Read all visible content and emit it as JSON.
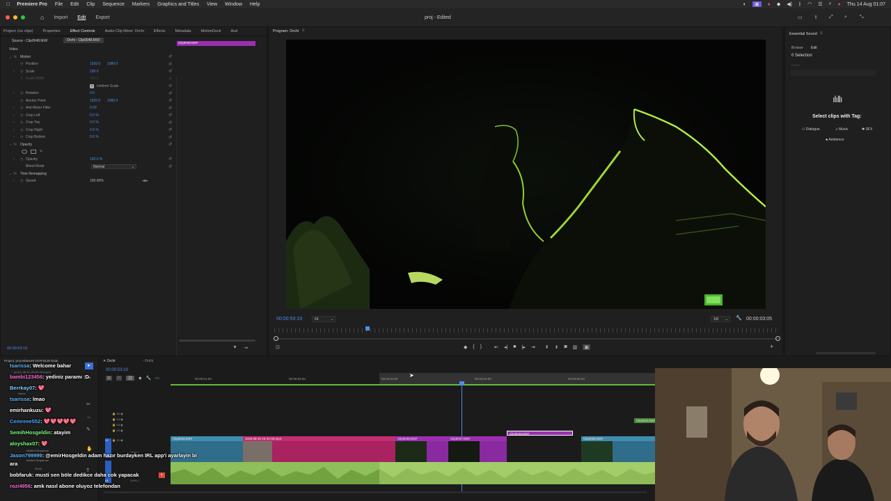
{
  "menubar": {
    "app": "Premiere Pro",
    "items": [
      "File",
      "Edit",
      "Clip",
      "Sequence",
      "Markers",
      "Graphics and Titles",
      "View",
      "Window",
      "Help"
    ],
    "datetime": "Thu 14 Aug  01:07"
  },
  "titlebar": {
    "nav": [
      "Import",
      "Edit",
      "Export"
    ],
    "active_nav": "Edit",
    "doc_title": "proj - Edited"
  },
  "effect_controls": {
    "tabs": [
      "Project: (no clips)",
      "Properties",
      "Effect Controls",
      "Audio Clip Mixer: Orchi",
      "Effects",
      "Metadata",
      "MotionDuck",
      "Aud"
    ],
    "source_label": "Source - Clip0048.MXF",
    "sequence_label": "Orchi - Clip0048.MXF",
    "mini_clip": "Clip0048.MXF",
    "section_video": "Video",
    "rows": [
      {
        "label": "Motion",
        "header": true
      },
      {
        "label": "Position",
        "v1": "1920.0",
        "v2": "1080.0"
      },
      {
        "label": "Scale",
        "v1": "100.0"
      },
      {
        "label": "Scale Width",
        "v1": "100.0",
        "dim": true
      },
      {
        "label": "Uniform Scale",
        "checkbox": true
      },
      {
        "label": "Rotation",
        "v1": "0.0"
      },
      {
        "label": "Anchor Point",
        "v1": "1920.0",
        "v2": "1080.0"
      },
      {
        "label": "Anti-flicker Filter",
        "v1": "0.00"
      },
      {
        "label": "Crop Left",
        "v1": "0.0 %"
      },
      {
        "label": "Crop Top",
        "v1": "0.0 %"
      },
      {
        "label": "Crop Right",
        "v1": "0.0 %"
      },
      {
        "label": "Crop Bottom",
        "v1": "0.0 %"
      },
      {
        "label": "Opacity",
        "header": true
      },
      {
        "label": "",
        "masks": true
      },
      {
        "label": "Opacity",
        "v1": "100.0 %"
      },
      {
        "label": "Blend Mode",
        "select": "Normal"
      },
      {
        "label": "Time Remapping",
        "header": true
      },
      {
        "label": "Speed",
        "v1": "100.00%"
      }
    ],
    "timecode": "00:00:53:19"
  },
  "program_monitor": {
    "title": "Program: Orchi",
    "timecode": "00:00:53:19",
    "fit": "Fit",
    "resolution": "1/8",
    "duration": "00:00:03:05"
  },
  "essential_sound": {
    "title": "Essential Sound",
    "tabs": [
      "Browse",
      "Edit"
    ],
    "selection": "0 Selection",
    "preset_label": "Preset",
    "prompt": "Select clips with Tag:",
    "tags": [
      "Dialogue",
      "Music",
      "SFX",
      "Ambience"
    ]
  },
  "timeline": {
    "project_label": "Project: proj-e83ee49-1879-81de-81de",
    "project_file": "proj-rt_08-14_00-04-15.prproj",
    "name_col": "Name",
    "seq_tabs": [
      "Orchi",
      "Orchi"
    ],
    "timecode": "00:00:53:19",
    "ruler": [
      "00:00:51:00",
      "00:00:52:00",
      "00:00:53:00",
      "00:00:54:00",
      "00:00:55:00"
    ],
    "tracks_v": [
      "V5",
      "V4",
      "V3",
      "V2",
      "V1"
    ],
    "track_a": "A1",
    "clips_top": [
      {
        "name": "Clip0015.MXF"
      },
      {
        "name": "2025-08-10 16-32-06.mp4"
      },
      {
        "name": "Clip0048.MXF"
      },
      {
        "name": "Clip0047.MXF"
      },
      {
        "name": "Clip0048.MXF"
      },
      {
        "name": "Clip0035.MXF"
      },
      {
        "name": "Clip0015.MXF"
      }
    ],
    "nested": [
      "Nested Sequence",
      "Nested Sequence",
      "Orchi"
    ],
    "video1": "Video 1",
    "audio1": "Audio 1"
  },
  "chat": [
    {
      "user": "tsarissa",
      "msg": "Welcome bahar",
      "color": "#5fb8ff"
    },
    {
      "user": "bambi123456",
      "msg": "yediniz paramı :D",
      "color": "#ff6ad5"
    },
    {
      "user": "Berrkay07",
      "msg": "💖",
      "color": "#7fd0ff"
    },
    {
      "user": "tsarissa",
      "msg": "lmao",
      "color": "#5fb8ff"
    },
    {
      "user": "emirhankuzu",
      "msg": "💖",
      "color": "#ffffff"
    },
    {
      "user": "Cemreee552",
      "msg": "💖💖💖💖💖",
      "color": "#4aa8ff"
    },
    {
      "user": "SemihHosgeldin",
      "msg": "atayim",
      "color": "#7dff7d"
    },
    {
      "user": "aloyshax07",
      "msg": "💖",
      "color": "#7dff7d"
    },
    {
      "user": "Jason799999",
      "msg": "@emirHosgeldin adam hazır burdayken IRL app'i ayarlayin bi ara",
      "color": "#5fb8ff"
    },
    {
      "user": "bobfaruk",
      "msg": "musti sen böle dedikce daha cok yapacak",
      "color": "#ffffff"
    },
    {
      "user": "rozi4956",
      "msg": "amk nasıl abone oluyoz telefondan",
      "color": "#ff6ad5"
    }
  ]
}
